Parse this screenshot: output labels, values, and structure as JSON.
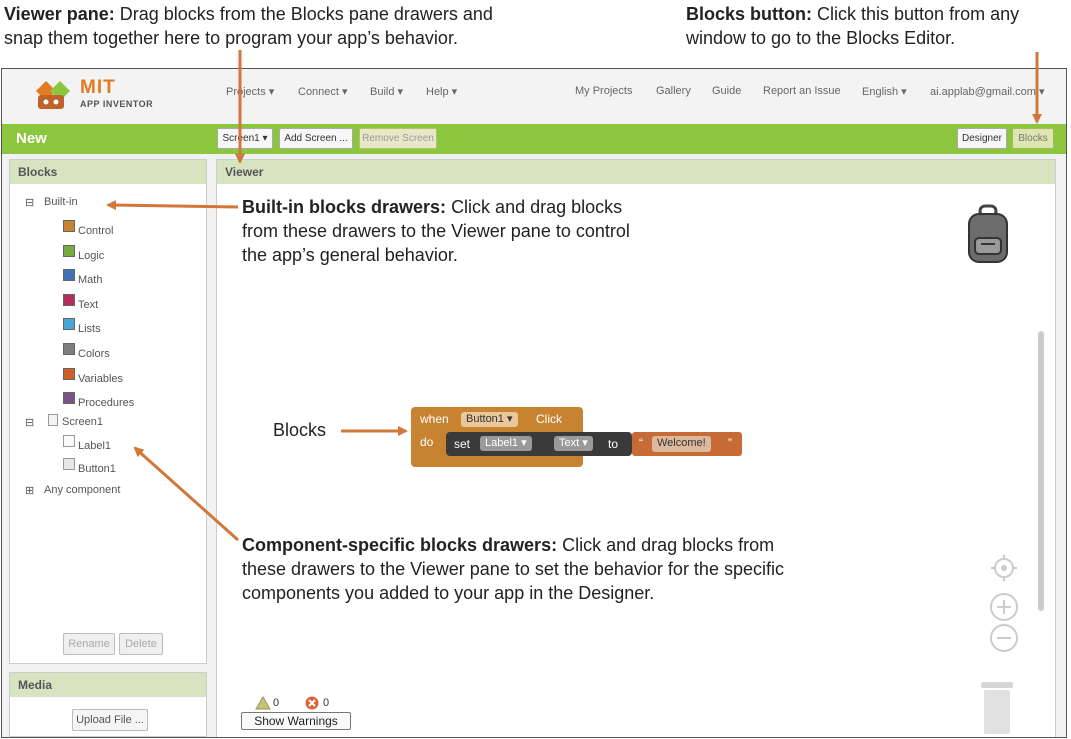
{
  "callouts": {
    "viewer_pane": {
      "title": "Viewer pane:",
      "line1": "Drag blocks from the Blocks pane drawers and",
      "line2": "snap them together here to program your app’s behavior."
    },
    "blocks_button": {
      "title": "Blocks button:",
      "line1": "Click this button from any",
      "line2": "window to go to the Blocks Editor."
    },
    "builtin": {
      "title": "Built-in blocks drawers:",
      "line1": "Click and drag blocks",
      "line2": "from these drawers to the Viewer pane to control",
      "line3": "the app’s general behavior."
    },
    "blocks_label": "Blocks",
    "component": {
      "title": "Component-specific blocks drawers:",
      "line1": "Click and drag blocks from",
      "line2": "these drawers to the Viewer pane to set the behavior for the specific",
      "line3": "components you added to your app in the Designer."
    }
  },
  "logo": {
    "mit": "MIT",
    "app_inventor": "APP INVENTOR"
  },
  "topnav": {
    "projects": "Projects ▾",
    "connect": "Connect ▾",
    "build": "Build ▾",
    "help": "Help ▾",
    "my_projects": "My Projects",
    "gallery": "Gallery",
    "guide": "Guide",
    "report": "Report an Issue",
    "language": "English ▾",
    "account": "ai.applab@gmail.com ▾"
  },
  "toolbar": {
    "project_name": "New",
    "screen_select": "Screen1 ▾",
    "add_screen": "Add Screen ...",
    "remove_screen": "Remove Screen",
    "designer": "Designer",
    "blocks": "Blocks"
  },
  "blocks_panel": {
    "header": "Blocks",
    "builtin_toggle": "⊟",
    "builtin_label": "Built-in",
    "drawers": [
      {
        "label": "Control",
        "color": "#c88330"
      },
      {
        "label": "Logic",
        "color": "#77ab41"
      },
      {
        "label": "Math",
        "color": "#3f71b5"
      },
      {
        "label": "Text",
        "color": "#b32d5e"
      },
      {
        "label": "Lists",
        "color": "#49a6d4"
      },
      {
        "label": "Colors",
        "color": "#7d7d7d"
      },
      {
        "label": "Variables",
        "color": "#d05f2d"
      },
      {
        "label": "Procedures",
        "color": "#7c5385"
      }
    ],
    "screen_toggle": "⊟",
    "screen_label": "Screen1",
    "components": [
      "Label1",
      "Button1"
    ],
    "any_toggle": "⊞",
    "any_label": "Any component",
    "rename": "Rename",
    "delete": "Delete"
  },
  "media_panel": {
    "header": "Media",
    "upload": "Upload File ..."
  },
  "viewer": {
    "header": "Viewer",
    "warnings_count": "0",
    "errors_count": "0",
    "show_warnings": "Show Warnings"
  },
  "block": {
    "when": "when",
    "component": "Button1 ▾",
    "event": "Click",
    "do": "do",
    "set": "set",
    "target": "Label1 ▾",
    "property": "Text ▾",
    "to": "to",
    "value": "Welcome!"
  }
}
